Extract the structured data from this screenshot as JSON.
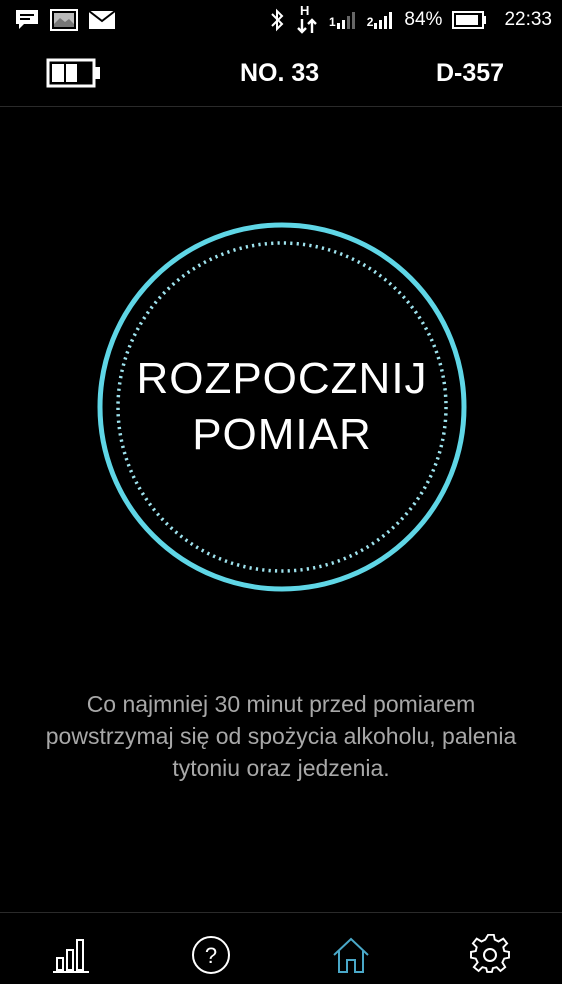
{
  "status_bar": {
    "icons_left": [
      "message-icon",
      "image-icon",
      "mail-icon"
    ],
    "icons_right": [
      "bluetooth-icon",
      "hspa-data-icon",
      "signal-sim1-icon",
      "signal-sim2-icon",
      "battery-icon"
    ],
    "sim1_label": "1",
    "sim2_label": "2",
    "data_label": "H",
    "battery_percent": "84%",
    "time": "22:33"
  },
  "header": {
    "device_battery_icon": "battery-icon",
    "device_battery_level": 0.66,
    "number": "NO. 33",
    "device_id": "D-357"
  },
  "main": {
    "start_button": {
      "line1": "ROZPOCZNIJ",
      "line2": "POMIAR"
    },
    "hint": {
      "line1": "Co najmniej 30 minut przed pomiarem",
      "line2": "powstrzymaj się od spożycia alkoholu, palenia",
      "line3": "tytoniu oraz jedzenia."
    }
  },
  "bottom_nav": {
    "items": [
      {
        "icon": "bar-chart-icon",
        "active": false
      },
      {
        "icon": "help-icon",
        "active": false
      },
      {
        "icon": "home-icon",
        "active": true
      },
      {
        "icon": "settings-icon",
        "active": false
      }
    ]
  },
  "colors": {
    "accent": "#5fd6e6",
    "dotted_ring": "#9fe3ee",
    "nav_active": "#4aa8c8",
    "hint_text": "#a8a8a8",
    "background": "#000000"
  }
}
